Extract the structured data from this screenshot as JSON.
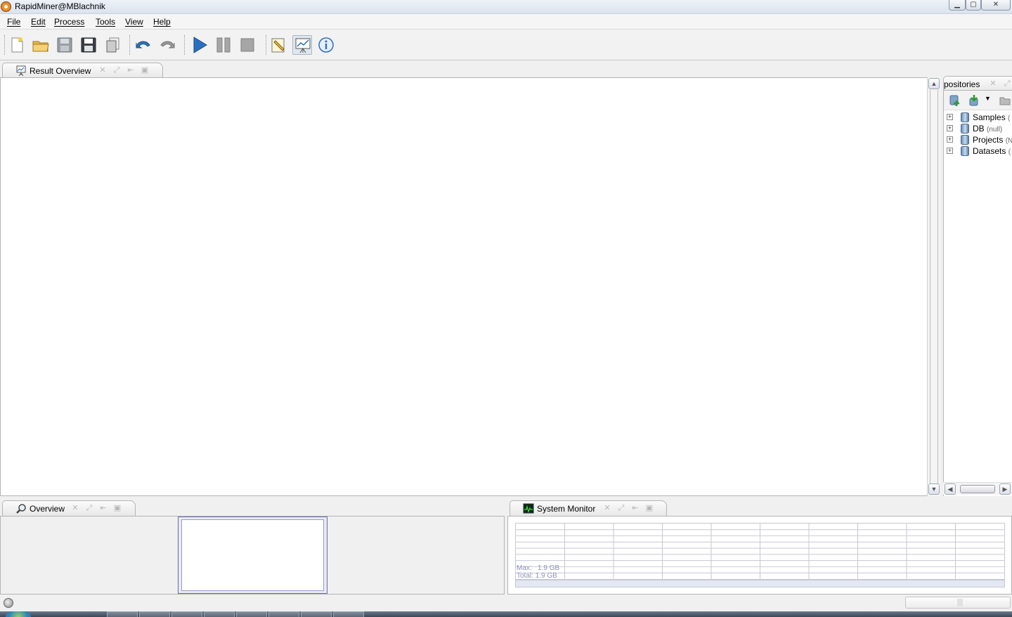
{
  "window": {
    "title": "RapidMiner@MBlachnik"
  },
  "menu": {
    "items": [
      "File",
      "Edit",
      "Process",
      "Tools",
      "View",
      "Help"
    ]
  },
  "toolbar": {
    "buttons": [
      "new-process",
      "open-process",
      "save-process",
      "save-process-as",
      "export",
      "undo",
      "redo",
      "run",
      "pause",
      "stop",
      "design-perspective",
      "result-perspective",
      "welcome-perspective"
    ]
  },
  "result_panel": {
    "tab_label": "Result Overview"
  },
  "repositories_panel": {
    "tab_label": "positories",
    "items": [
      {
        "name": "Samples",
        "sub": "("
      },
      {
        "name": "DB",
        "sub": "(null)"
      },
      {
        "name": "Projects",
        "sub": "(N"
      },
      {
        "name": "Datasets",
        "sub": "("
      }
    ]
  },
  "overview_panel": {
    "tab_label": "Overview"
  },
  "system_monitor": {
    "tab_label": "System Monitor",
    "max_label": "Max:",
    "max_value": "1.9 GB",
    "total_label": "Total:",
    "total_value": "1.9 GB"
  },
  "colors": {
    "accent": "#2a6fbf",
    "panel_border": "#b4b4b4",
    "overview_frame": "#6b6bb5"
  }
}
